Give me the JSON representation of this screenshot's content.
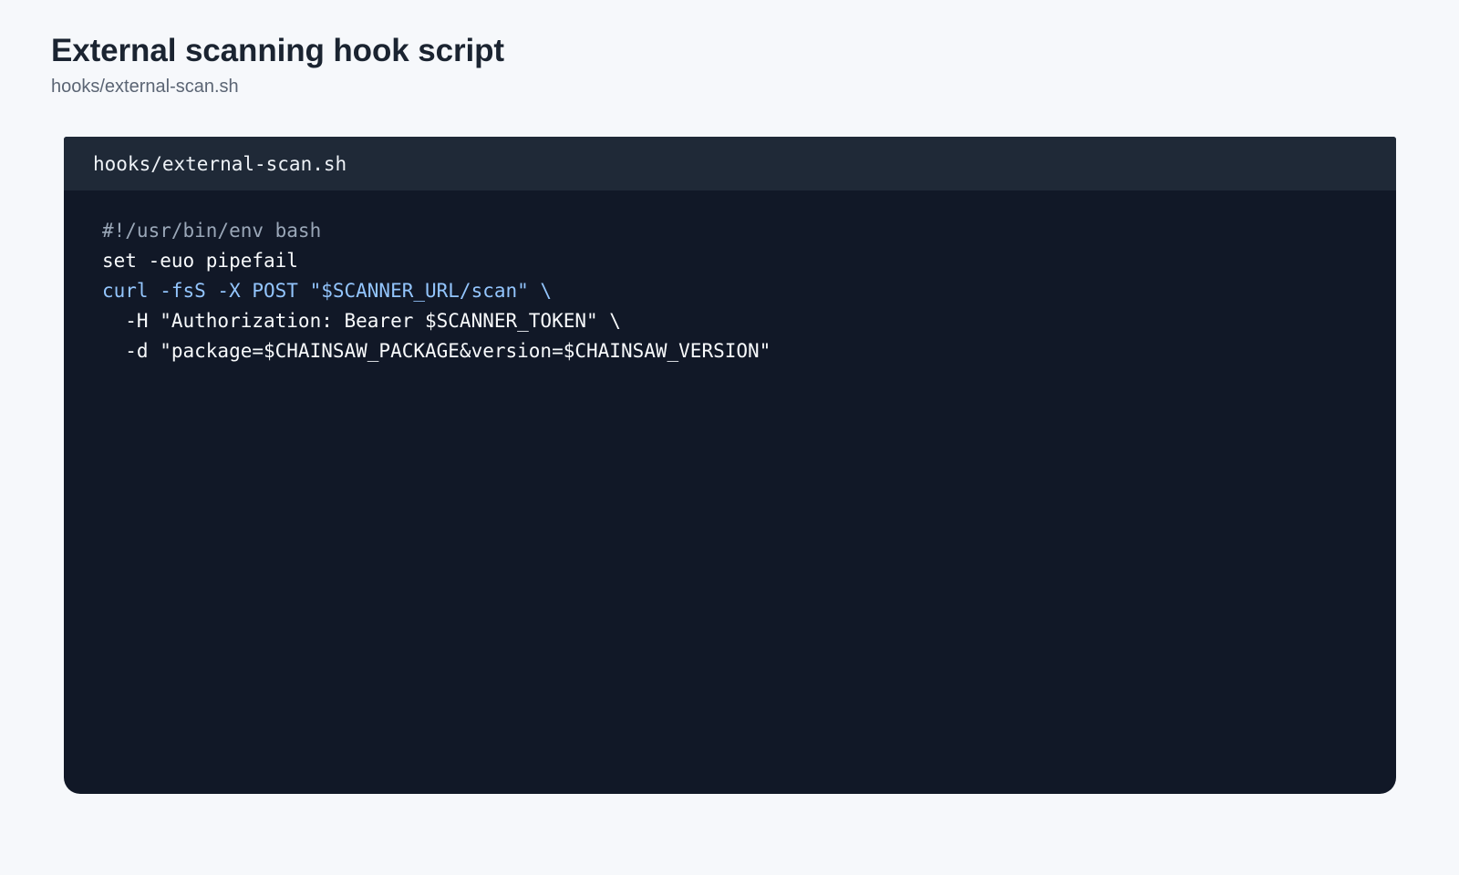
{
  "page": {
    "title": "External scanning hook script",
    "subtitle": "hooks/external-scan.sh"
  },
  "code_block": {
    "filename": "hooks/external-scan.sh",
    "lines": [
      {
        "text": "#!/usr/bin/env bash",
        "style": "comment",
        "color": "#9aa7b8"
      },
      {
        "text": "set -euo pipefail",
        "style": "default",
        "color": "#f8fafc"
      },
      {
        "text": "curl -fsS -X POST \"$SCANNER_URL/scan\" \\",
        "style": "accent",
        "color": "#93c5fd"
      },
      {
        "text": "  -H \"Authorization: Bearer $SCANNER_TOKEN\" \\",
        "style": "default",
        "color": "#f8fafc"
      },
      {
        "text": "  -d \"package=$CHAINSAW_PACKAGE&version=$CHAINSAW_VERSION\"",
        "style": "default",
        "color": "#f8fafc"
      }
    ]
  },
  "colors": {
    "page_background": "#f6f8fb",
    "title_text": "#1b2431",
    "subtitle_text": "#5b6574",
    "code_background": "#111827",
    "code_header_background": "#1f2937"
  }
}
